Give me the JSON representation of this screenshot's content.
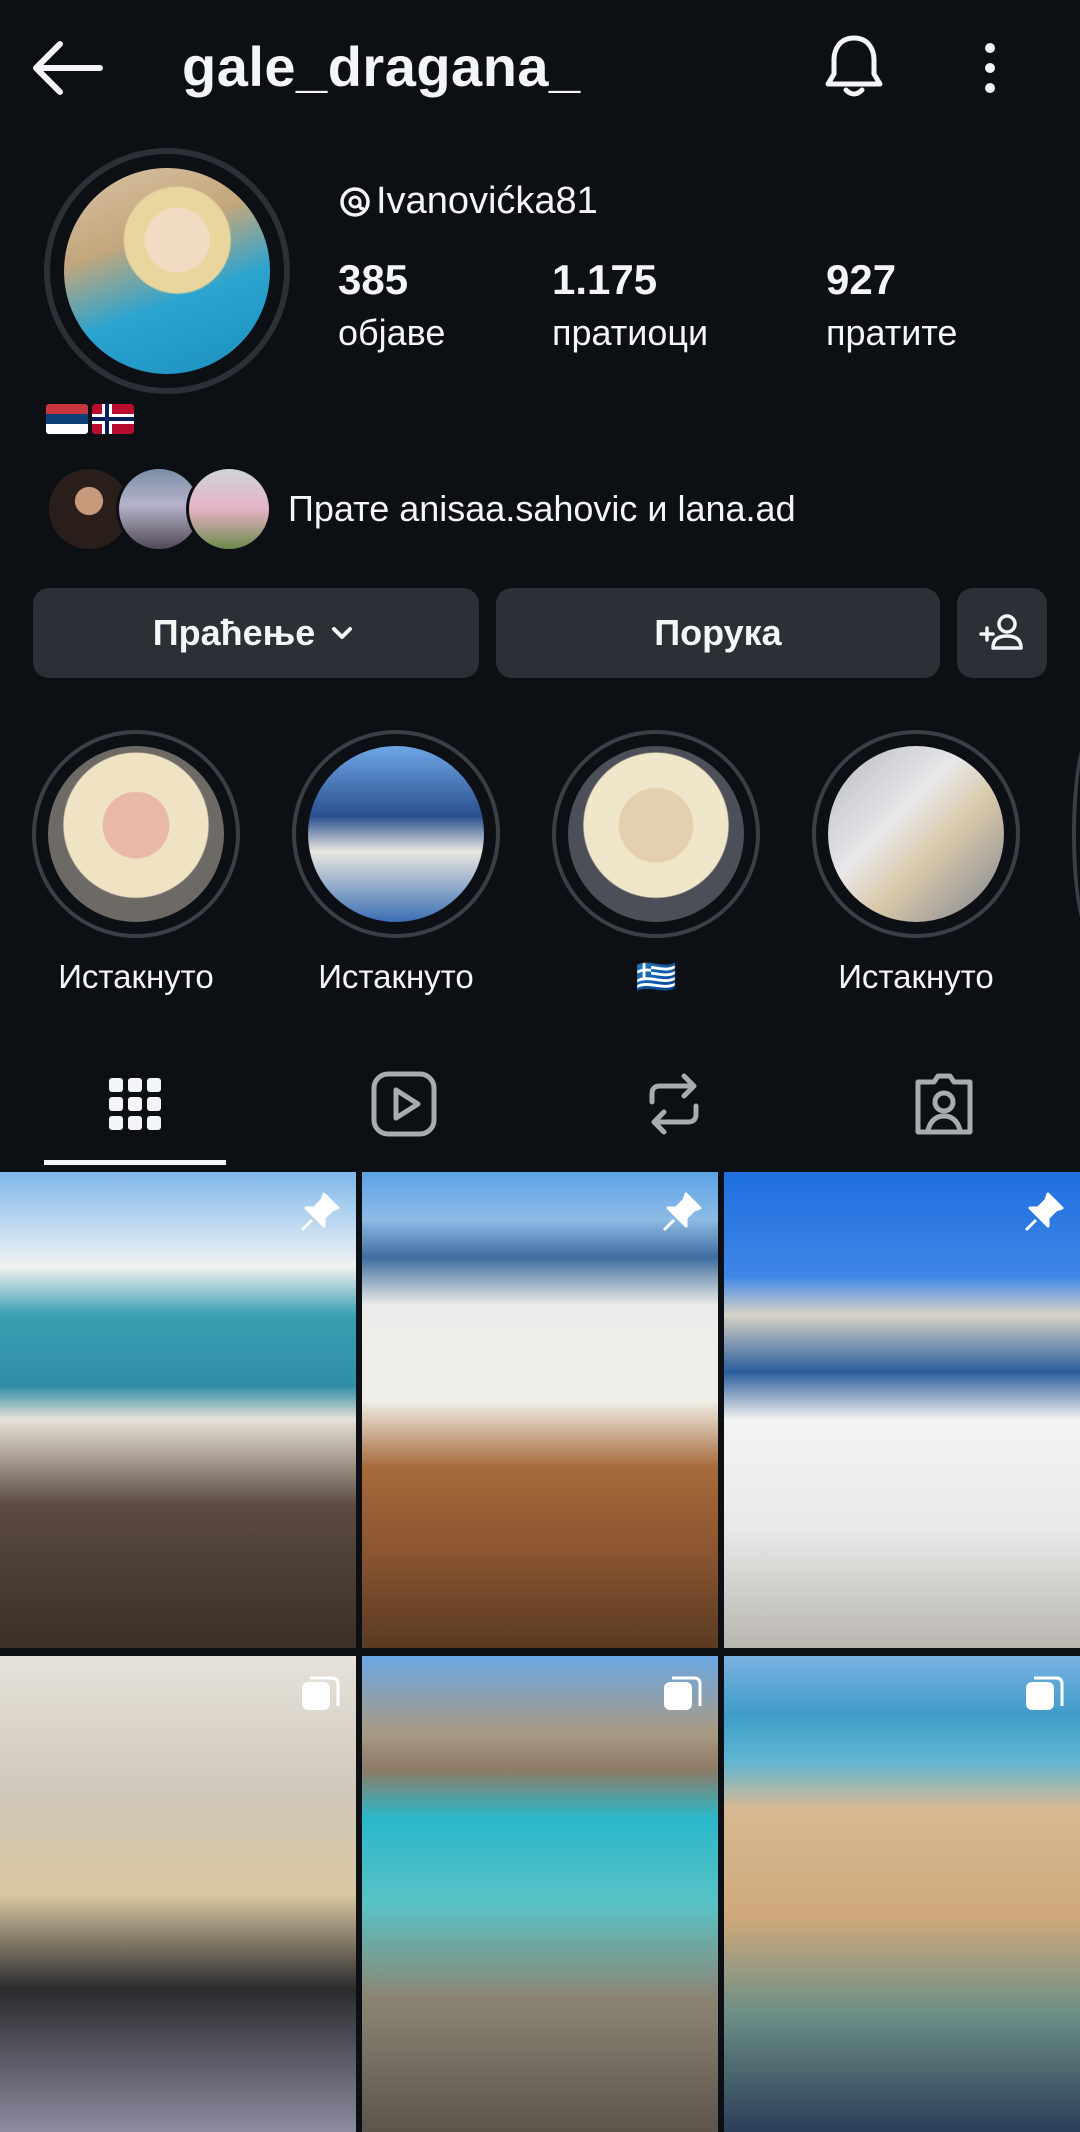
{
  "header": {
    "username": "gale_dragana_",
    "icons": {
      "back": "back-arrow-icon",
      "notifications": "bell-icon",
      "more": "more-vertical-icon"
    }
  },
  "profile": {
    "threads_handle": "Ivanovićka81",
    "threads_icon": "threads-icon",
    "stats": [
      {
        "value": "385",
        "label": "објаве"
      },
      {
        "value": "1.175",
        "label": "пратиоци"
      },
      {
        "value": "927",
        "label": "пратите"
      }
    ],
    "bio_flags": [
      "serbia-flag",
      "norway-flag"
    ],
    "mutuals_text": "Прате anisaa.sahovic и lana.ad"
  },
  "actions": {
    "follow_label": "Праћење",
    "message_label": "Порука",
    "add_friend_icon": "add-person-icon"
  },
  "highlights": [
    {
      "label": "Истакнуто"
    },
    {
      "label": "Истакнуто"
    },
    {
      "label": "🇬🇷"
    },
    {
      "label": "Истакнуто"
    }
  ],
  "tabs": [
    {
      "name": "posts",
      "icon": "grid-icon",
      "active": true
    },
    {
      "name": "reels",
      "icon": "reels-icon",
      "active": false
    },
    {
      "name": "reposts",
      "icon": "repost-icon",
      "active": false
    },
    {
      "name": "tagged",
      "icon": "tagged-icon",
      "active": false
    }
  ],
  "posts": [
    {
      "badge": "pin-icon"
    },
    {
      "badge": "pin-icon"
    },
    {
      "badge": "pin-icon"
    },
    {
      "badge": "carousel-icon"
    },
    {
      "badge": "carousel-icon"
    },
    {
      "badge": "carousel-icon"
    }
  ],
  "colors": {
    "background": "#0c0f14",
    "button": "#2b2f36",
    "text": "#f3f5f7"
  }
}
